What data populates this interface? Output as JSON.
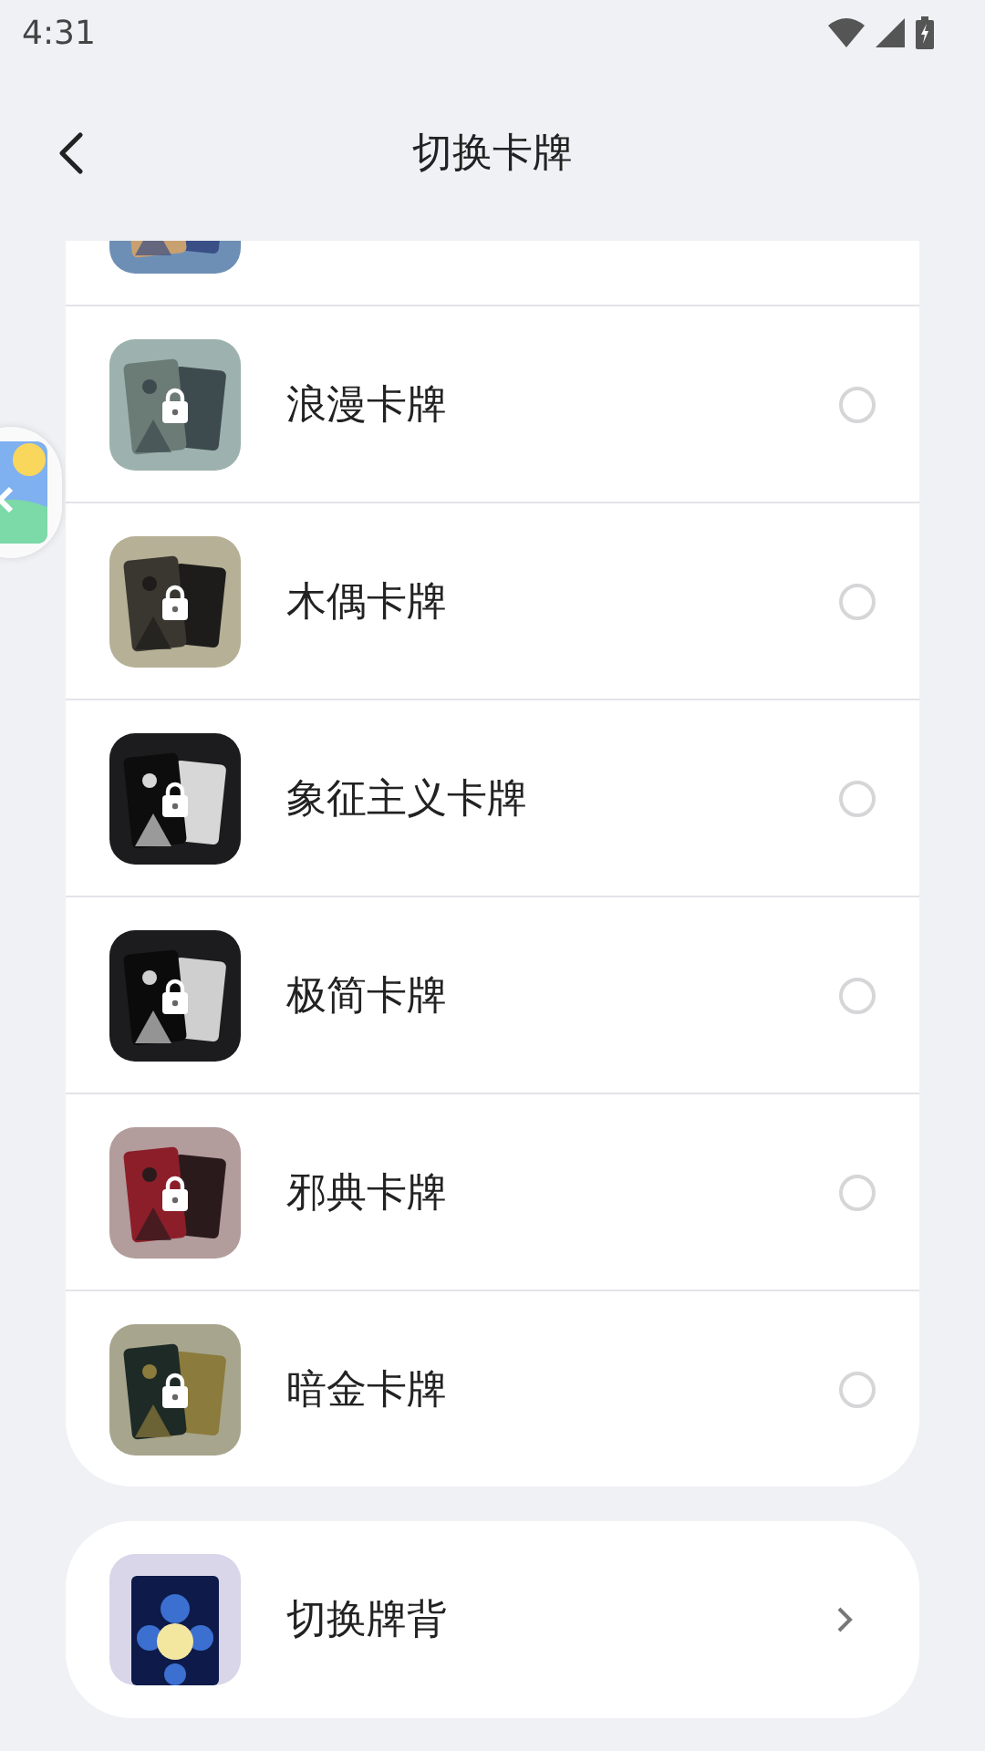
{
  "status_bar": {
    "time": "4:31"
  },
  "header": {
    "title": "切换卡牌"
  },
  "cards": [
    {
      "kind": "partial"
    },
    {
      "kind": "card",
      "name": "浪漫卡牌",
      "locked": true,
      "selected": false
    },
    {
      "kind": "card",
      "name": "木偶卡牌",
      "locked": true,
      "selected": false
    },
    {
      "kind": "card",
      "name": "象征主义卡牌",
      "locked": true,
      "selected": false
    },
    {
      "kind": "card",
      "name": "极简卡牌",
      "locked": true,
      "selected": false
    },
    {
      "kind": "card",
      "name": "邪典卡牌",
      "locked": true,
      "selected": false
    },
    {
      "kind": "card",
      "name": "暗金卡牌",
      "locked": true,
      "selected": false
    }
  ],
  "back_option": {
    "label": "切换牌背"
  }
}
